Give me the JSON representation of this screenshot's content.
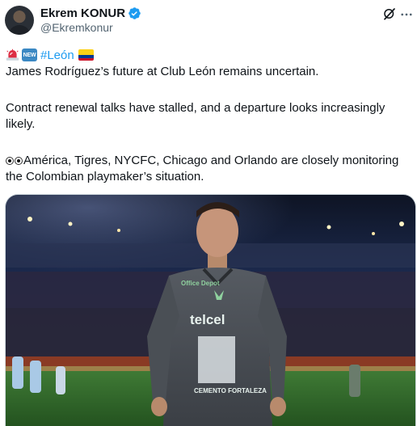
{
  "tweet": {
    "author": {
      "display_name": "Ekrem KONUR",
      "handle": "@Ekremkonur",
      "verified": true
    },
    "header_icons": [
      "grok-icon",
      "more-icon"
    ],
    "hashtag": "#León",
    "lead_emojis": [
      "siren-emoji",
      "new-emoji"
    ],
    "new_badge": "NEW",
    "trail_emoji": "colombia-flag-emoji",
    "text_line1": "James Rodríguez’s future at Club León remains uncertain.",
    "text_line2": "Contract renewal talks have stalled, and a departure looks increasingly likely.",
    "text_line3_emoji": "eyes-emoji",
    "text_line3": "América, Tigres, NYCFC, Chicago and Orlando are closely monitoring the Colombian playmaker’s situation.",
    "media": {
      "description": "Football player in dark grey León jersey walking on pitch at night stadium",
      "jersey_sponsor_top": "Office Depot",
      "jersey_sponsor_main": "telcel",
      "jersey_sponsor_lower": "CEMENTO FORTALEZA",
      "colors": {
        "jersey": "#4a4f55",
        "pitch": "#2f6a2c",
        "crowd": "#1a2240"
      }
    },
    "colors": {
      "text": "#0f1419",
      "secondary": "#536471",
      "link": "#1d9bf0",
      "verified": "#1d9bf0"
    }
  }
}
